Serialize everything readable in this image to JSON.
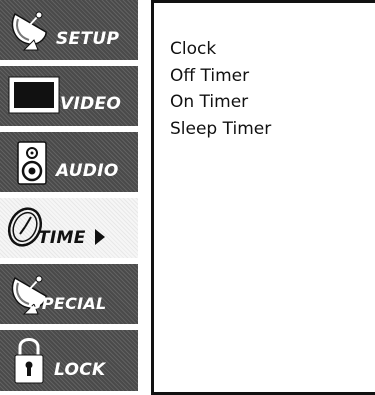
{
  "menu": {
    "items": [
      {
        "label": "SETUP",
        "icon": "satellite-dish-icon",
        "selected": false
      },
      {
        "label": "VIDEO",
        "icon": "tv-screen-icon",
        "selected": false
      },
      {
        "label": "AUDIO",
        "icon": "speaker-icon",
        "selected": false
      },
      {
        "label": "TIME",
        "icon": "clock-icon",
        "selected": true
      },
      {
        "label": "SPECIAL",
        "icon": "satellite-dish-icon",
        "selected": false
      },
      {
        "label": "LOCK",
        "icon": "padlock-icon",
        "selected": false
      }
    ]
  },
  "submenu": {
    "options": [
      "Clock",
      "Off Timer",
      "On Timer",
      "Sleep Timer"
    ]
  }
}
